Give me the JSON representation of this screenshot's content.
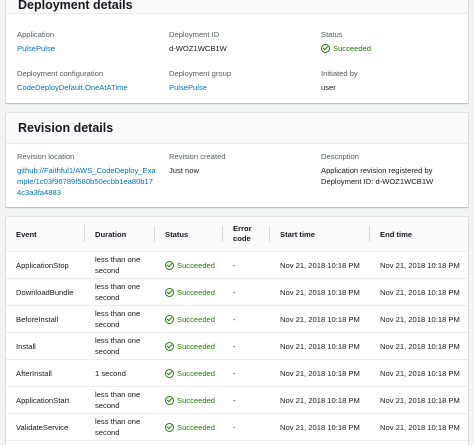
{
  "deployment": {
    "title": "Deployment details",
    "application_label": "Application",
    "application_value": "PulsePulse",
    "deployment_id_label": "Deployment ID",
    "deployment_id_value": "d-WOZ1WCB1W",
    "status_label": "Status",
    "status_value": "Succeeded",
    "config_label": "Deployment configuration",
    "config_value": "CodeDeployDefault.OneAtATime",
    "group_label": "Deployment group",
    "group_value": "PulsePulse",
    "initiated_label": "Initiated by",
    "initiated_value": "user"
  },
  "revision": {
    "title": "Revision details",
    "location_label": "Revision location",
    "location_value": "github://Faithful1/AWS_CodeDeploy_Example/1c03f96789f580b50ecbb1ea80b174c3a3fa4883",
    "created_label": "Revision created",
    "created_value": "Just now",
    "description_label": "Description",
    "description_value": "Application revision registered by Deployment ID: d-WOZ1WCB1W"
  },
  "events": {
    "columns": [
      "Event",
      "Duration",
      "Status",
      "Error code",
      "Start time",
      "End time"
    ],
    "rows": [
      {
        "event": "ApplicationStop",
        "duration": "less than one second",
        "status": "Succeeded",
        "error": "-",
        "start": "Nov 21, 2018 10:18 PM",
        "end": "Nov 21, 2018 10:18 PM"
      },
      {
        "event": "DownloadBundle",
        "duration": "less than one second",
        "status": "Succeeded",
        "error": "-",
        "start": "Nov 21, 2018 10:18 PM",
        "end": "Nov 21, 2018 10:18 PM"
      },
      {
        "event": "BeforeInstall",
        "duration": "less than one second",
        "status": "Succeeded",
        "error": "-",
        "start": "Nov 21, 2018 10:18 PM",
        "end": "Nov 21, 2018 10:18 PM"
      },
      {
        "event": "Install",
        "duration": "less than one second",
        "status": "Succeeded",
        "error": "-",
        "start": "Nov 21, 2018 10:18 PM",
        "end": "Nov 21, 2018 10:18 PM"
      },
      {
        "event": "AfterInstall",
        "duration": "1 second",
        "status": "Succeeded",
        "error": "-",
        "start": "Nov 21, 2018 10:18 PM",
        "end": "Nov 21, 2018 10:18 PM"
      },
      {
        "event": "ApplicationStart",
        "duration": "less than one second",
        "status": "Succeeded",
        "error": "-",
        "start": "Nov 21, 2018 10:18 PM",
        "end": "Nov 21, 2018 10:18 PM"
      },
      {
        "event": "ValidateService",
        "duration": "less than one second",
        "status": "Succeeded",
        "error": "-",
        "start": "Nov 21, 2018 10:18 PM",
        "end": "Nov 21, 2018 10:18 PM"
      }
    ]
  },
  "colors": {
    "link": "#0073bb",
    "success": "#1d8102",
    "background": "#f2f3f3"
  },
  "icons": {
    "status": "success-check-icon"
  }
}
